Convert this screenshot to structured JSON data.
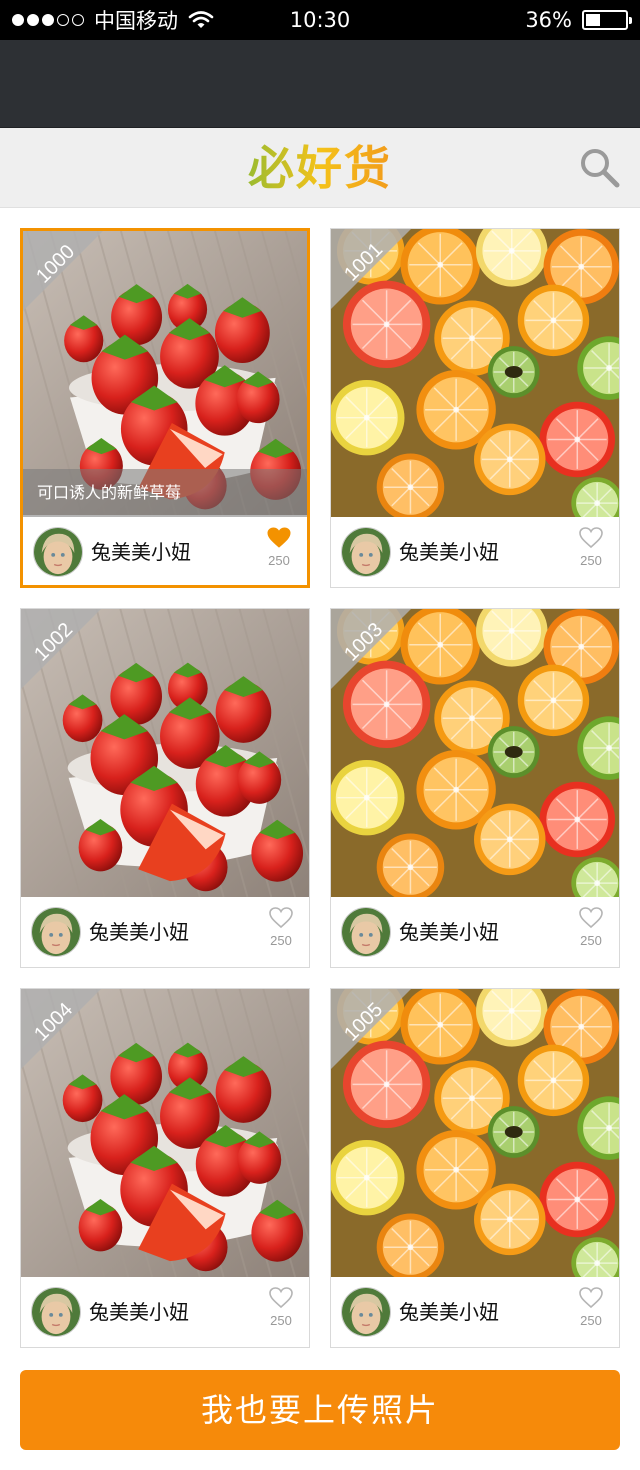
{
  "status_bar": {
    "carrier": "中国移动",
    "time": "10:30",
    "battery": "36%",
    "battery_level": 0.36,
    "signal_bars": 3,
    "signal_total": 5
  },
  "header": {
    "title": "必好货",
    "search_icon": "search-icon",
    "title_colors": [
      "#1b8fe0",
      "#2fb34a",
      "#f4c21a",
      "#ef6b1c",
      "#2c7fe0"
    ]
  },
  "cards": [
    {
      "number": "1000",
      "image": "strawberries",
      "caption": "可口诱人的新鲜草莓",
      "user": "兔美美小妞",
      "likes": "250",
      "liked": true,
      "selected": true
    },
    {
      "number": "1001",
      "image": "citrus",
      "caption": "",
      "user": "兔美美小妞",
      "likes": "250",
      "liked": false,
      "selected": false
    },
    {
      "number": "1002",
      "image": "strawberries",
      "caption": "",
      "user": "兔美美小妞",
      "likes": "250",
      "liked": false,
      "selected": false
    },
    {
      "number": "1003",
      "image": "citrus",
      "caption": "",
      "user": "兔美美小妞",
      "likes": "250",
      "liked": false,
      "selected": false
    },
    {
      "number": "1004",
      "image": "strawberries",
      "caption": "",
      "user": "兔美美小妞",
      "likes": "250",
      "liked": false,
      "selected": false
    },
    {
      "number": "1005",
      "image": "citrus",
      "caption": "",
      "user": "兔美美小妞",
      "likes": "250",
      "liked": false,
      "selected": false
    }
  ],
  "upload_button": {
    "label": "我也要上传照片"
  },
  "colors": {
    "accent": "#f68a0a",
    "selected_border": "#f39200",
    "liked_heart": "#f39200",
    "unliked_heart": "#b5b5b5"
  }
}
